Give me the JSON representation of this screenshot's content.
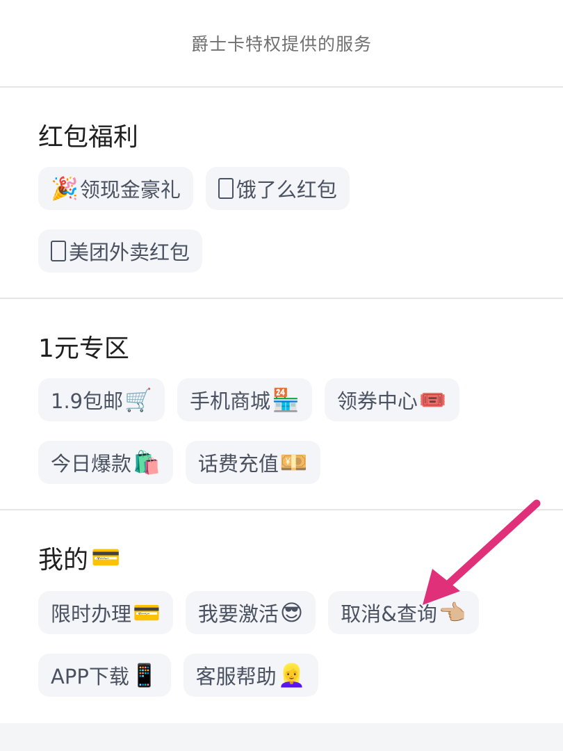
{
  "header": {
    "title": "爵士卡特权提供的服务"
  },
  "sections": [
    {
      "title": "红包福利",
      "rows": [
        [
          {
            "label": "领现金豪礼",
            "emoji": "🎉",
            "emoji_pos": "before"
          },
          {
            "label": "饿了么红包",
            "emoji": "",
            "emoji_pos": "before",
            "box_placeholder": true
          }
        ],
        [
          {
            "label": "美团外卖红包",
            "emoji": "",
            "emoji_pos": "before",
            "box_placeholder": true
          }
        ]
      ]
    },
    {
      "title": "1元专区",
      "rows": [
        [
          {
            "label": "1.9包邮",
            "emoji": "🛒",
            "emoji_pos": "after"
          },
          {
            "label": "手机商城",
            "emoji": "🏪",
            "emoji_pos": "after"
          },
          {
            "label": "领券中心",
            "emoji": "🎟️",
            "emoji_pos": "after"
          }
        ],
        [
          {
            "label": "今日爆款",
            "emoji": "🛍️",
            "emoji_pos": "after"
          },
          {
            "label": "话费充值",
            "emoji": "💴",
            "emoji_pos": "after"
          }
        ]
      ]
    },
    {
      "title": "我的",
      "title_emoji": "💳",
      "rows": [
        [
          {
            "label": "限时办理",
            "emoji": "💳",
            "emoji_pos": "after"
          },
          {
            "label": "我要激活",
            "emoji": "😎",
            "emoji_pos": "after"
          },
          {
            "label": "取消&查询",
            "emoji": "👈🏼",
            "emoji_pos": "after"
          }
        ],
        [
          {
            "label": "APP下载",
            "emoji": "📱",
            "emoji_pos": "after"
          },
          {
            "label": "客服帮助",
            "emoji": "👱‍♀️",
            "emoji_pos": "after"
          }
        ]
      ]
    }
  ],
  "annotation": {
    "arrow_color": "#e0307a",
    "points_to": "取消&查询"
  },
  "colors": {
    "chip_bg": "#f4f5f8",
    "chip_text": "#4a5160",
    "divider": "#e6e6e6",
    "header_text": "#707070"
  }
}
